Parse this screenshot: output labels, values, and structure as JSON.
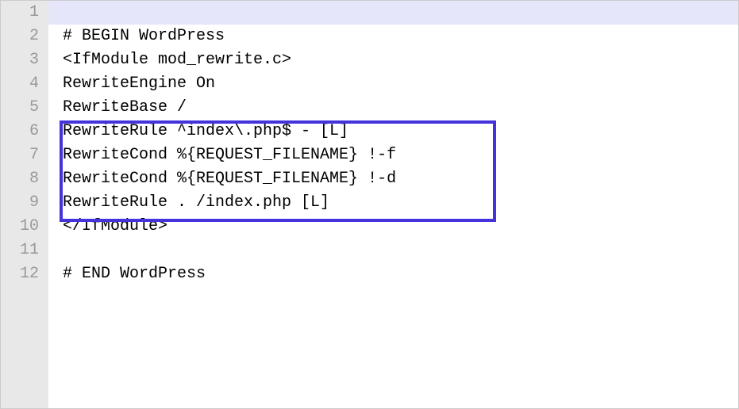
{
  "lines": [
    {
      "num": "1",
      "text": ""
    },
    {
      "num": "2",
      "text": "# BEGIN WordPress"
    },
    {
      "num": "3",
      "text": "<IfModule mod_rewrite.c>"
    },
    {
      "num": "4",
      "text": "RewriteEngine On"
    },
    {
      "num": "5",
      "text": "RewriteBase /"
    },
    {
      "num": "6",
      "text": "RewriteRule ^index\\.php$ - [L]"
    },
    {
      "num": "7",
      "text": "RewriteCond %{REQUEST_FILENAME} !-f"
    },
    {
      "num": "8",
      "text": "RewriteCond %{REQUEST_FILENAME} !-d"
    },
    {
      "num": "9",
      "text": "RewriteRule . /index.php [L]"
    },
    {
      "num": "10",
      "text": "</IfModule>"
    },
    {
      "num": "11",
      "text": ""
    },
    {
      "num": "12",
      "text": "# END WordPress"
    }
  ]
}
